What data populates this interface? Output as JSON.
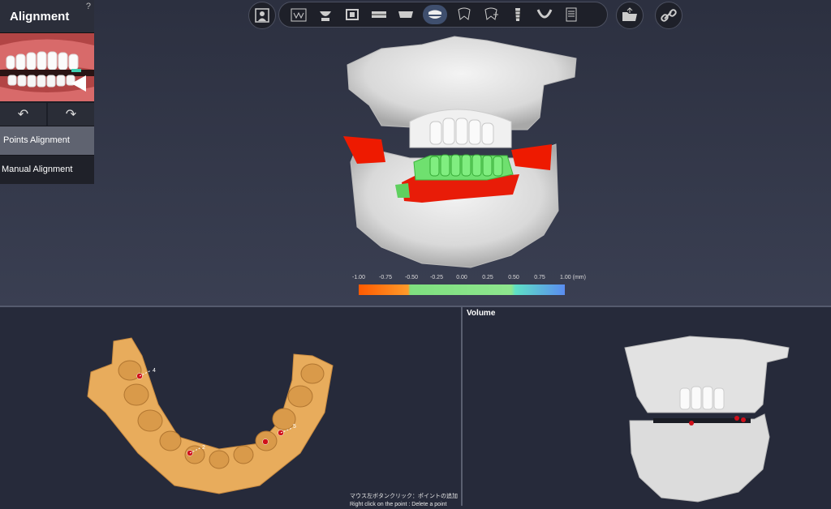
{
  "panel": {
    "title": "Alignment",
    "help": "?",
    "undo": "↶",
    "redo": "↷",
    "modes": [
      "Points Alignment",
      "Manual Alignment"
    ]
  },
  "toolbar": {
    "tools": [
      "patient-icon",
      "chart-icon",
      "scan-icon",
      "crop-icon",
      "arch-icon",
      "jaw-icon",
      "alignment-icon",
      "tooth-icon",
      "tooth-plus-icon",
      "implant-icon",
      "guide-icon",
      "document-icon",
      "folder-icon",
      "link-icon"
    ],
    "active_tool": "alignment-icon"
  },
  "scale": {
    "labels": [
      "-1.00",
      "-0.75",
      "-0.50",
      "-0.25",
      "0.00",
      "0.25",
      "0.50",
      "0.75",
      "1.00 (mm)"
    ],
    "colors": {
      "low": "#ff5a00",
      "mid": "#8ee68e",
      "high": "#5a8cf0"
    }
  },
  "bottom": {
    "volume_title": "Volume",
    "point_labels": [
      "4",
      "2",
      "5"
    ],
    "hint_lines": [
      "マウス左ボタンクリック：ポイントの追加",
      "Right click on the point : Delete a point"
    ]
  }
}
